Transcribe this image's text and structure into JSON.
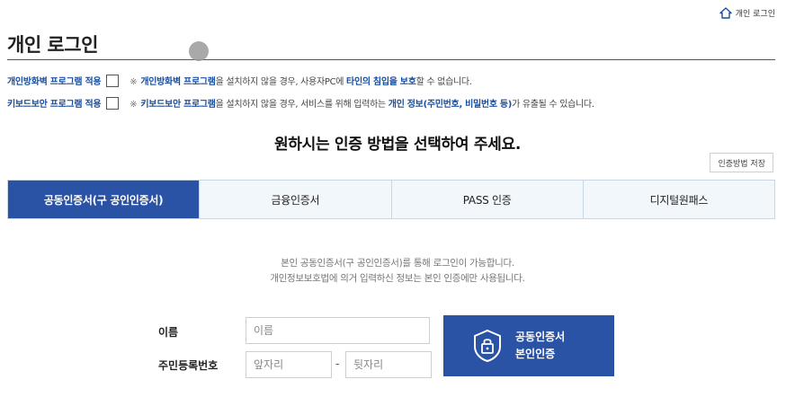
{
  "header": {
    "home_link_label": "개인 로그인",
    "page_title": "개인 로그인"
  },
  "security_options": [
    {
      "label": "개인방화벽 프로그램 적용",
      "checked": false,
      "note_mark": "※",
      "note_hl1": "개인방화벽 프로그램",
      "note_t1": "을 설치하지 않을 경우, 사용자PC에 ",
      "note_hl2": "타인의 침입을 보호",
      "note_t2": "할 수 없습니다."
    },
    {
      "label": "키보드보안 프로그램 적용",
      "checked": false,
      "note_mark": "※",
      "note_hl1": "키보드보안 프로그램",
      "note_t1": "을 설치하지 않을 경우, 서비스를 위해 입력하는 ",
      "note_hl2": "개인 정보(주민번호, 비밀번호 등)",
      "note_t2": "가 유출될 수 있습니다."
    }
  ],
  "headline": "원하시는 인증 방법을 선택하여 주세요.",
  "save_method_label": "인증방법 저장",
  "tabs": [
    {
      "label": "공동인증서(구 공인인증서)",
      "active": true
    },
    {
      "label": "금융인증서",
      "active": false
    },
    {
      "label": "PASS 인증",
      "active": false
    },
    {
      "label": "디지털원패스",
      "active": false
    }
  ],
  "info": {
    "line1": "본인 공동인증서(구 공인인증서)를 통해 로그인이 가능합니다.",
    "line2": "개인정보보호법에 의거 입력하신 정보는 본인 인증에만 사용됩니다."
  },
  "form": {
    "name_label": "이름",
    "name_placeholder": "이름",
    "rrn_label": "주민등록번호",
    "rrn_front_placeholder": "앞자리",
    "rrn_separator": "-",
    "rrn_back_placeholder": "뒷자리"
  },
  "cert_button": {
    "line1": "공동인증서",
    "line2": "본인인증"
  },
  "colors": {
    "accent": "#2a52a5",
    "link_blue": "#1a4fa0",
    "tab_bg": "#f2f7fc"
  },
  "icons": {
    "home": "home-icon",
    "certificate": "certificate-shield-icon"
  }
}
